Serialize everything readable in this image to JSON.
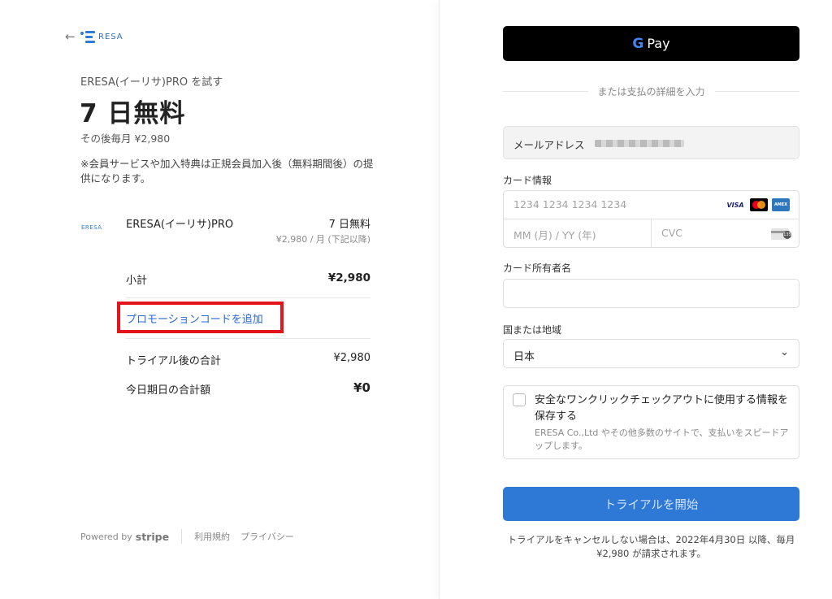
{
  "header": {
    "back_icon": "arrow-left-icon",
    "logo_text": "RESA"
  },
  "summary": {
    "trial_title": "ERESA(イーリサ)PRO を試す",
    "free_period": "7 日無料",
    "then_price": "その後毎月 ¥2,980",
    "note": "※会員サービスや加入特典は正規会員加入後（無料期間後）の提供になります。"
  },
  "product": {
    "icon_text": "ERESA",
    "name": "ERESA(イーリサ)PRO",
    "price": "7 日無料",
    "sub_price": "¥2,980 / 月 (下記以降)"
  },
  "totals": {
    "subtotal_label": "小計",
    "subtotal_value": "¥2,980",
    "promo_label": "プロモーションコードを追加",
    "after_trial_label": "トライアル後の合計",
    "after_trial_value": "¥2,980",
    "today_label": "今日期日の合計額",
    "today_value": "¥0"
  },
  "footer": {
    "powered_by": "Powered by",
    "stripe": "stripe",
    "terms": "利用規約",
    "privacy": "プライバシー"
  },
  "payment": {
    "gpay_g": "G",
    "gpay_label": "Pay",
    "or_text": "または支払の詳細を入力",
    "email_label": "メールアドレス",
    "card_label": "カード情報",
    "card_number_placeholder": "1234 1234 1234 1234",
    "expiry_placeholder": "MM (月) / YY (年)",
    "cvc_placeholder": "CVC",
    "card_brands": {
      "visa": "VISA",
      "amex": "AMEX"
    },
    "holder_label": "カード所有者名",
    "holder_value": "",
    "country_label": "国または地域",
    "country_value": "日本",
    "save_title": "安全なワンクリックチェックアウトに使用する情報を保存する",
    "save_desc": "ERESA Co.,Ltd やその他多数のサイトで、支払いをスピードアップします。",
    "start_button": "トライアルを開始",
    "bottom_note": "トライアルをキャンセルしない場合は、2022年4月30日 以降、毎月 ¥2,980 が請求されます。"
  },
  "colors": {
    "accent": "#2e78d6",
    "link": "#2868d4",
    "highlight": "#e3141c"
  }
}
